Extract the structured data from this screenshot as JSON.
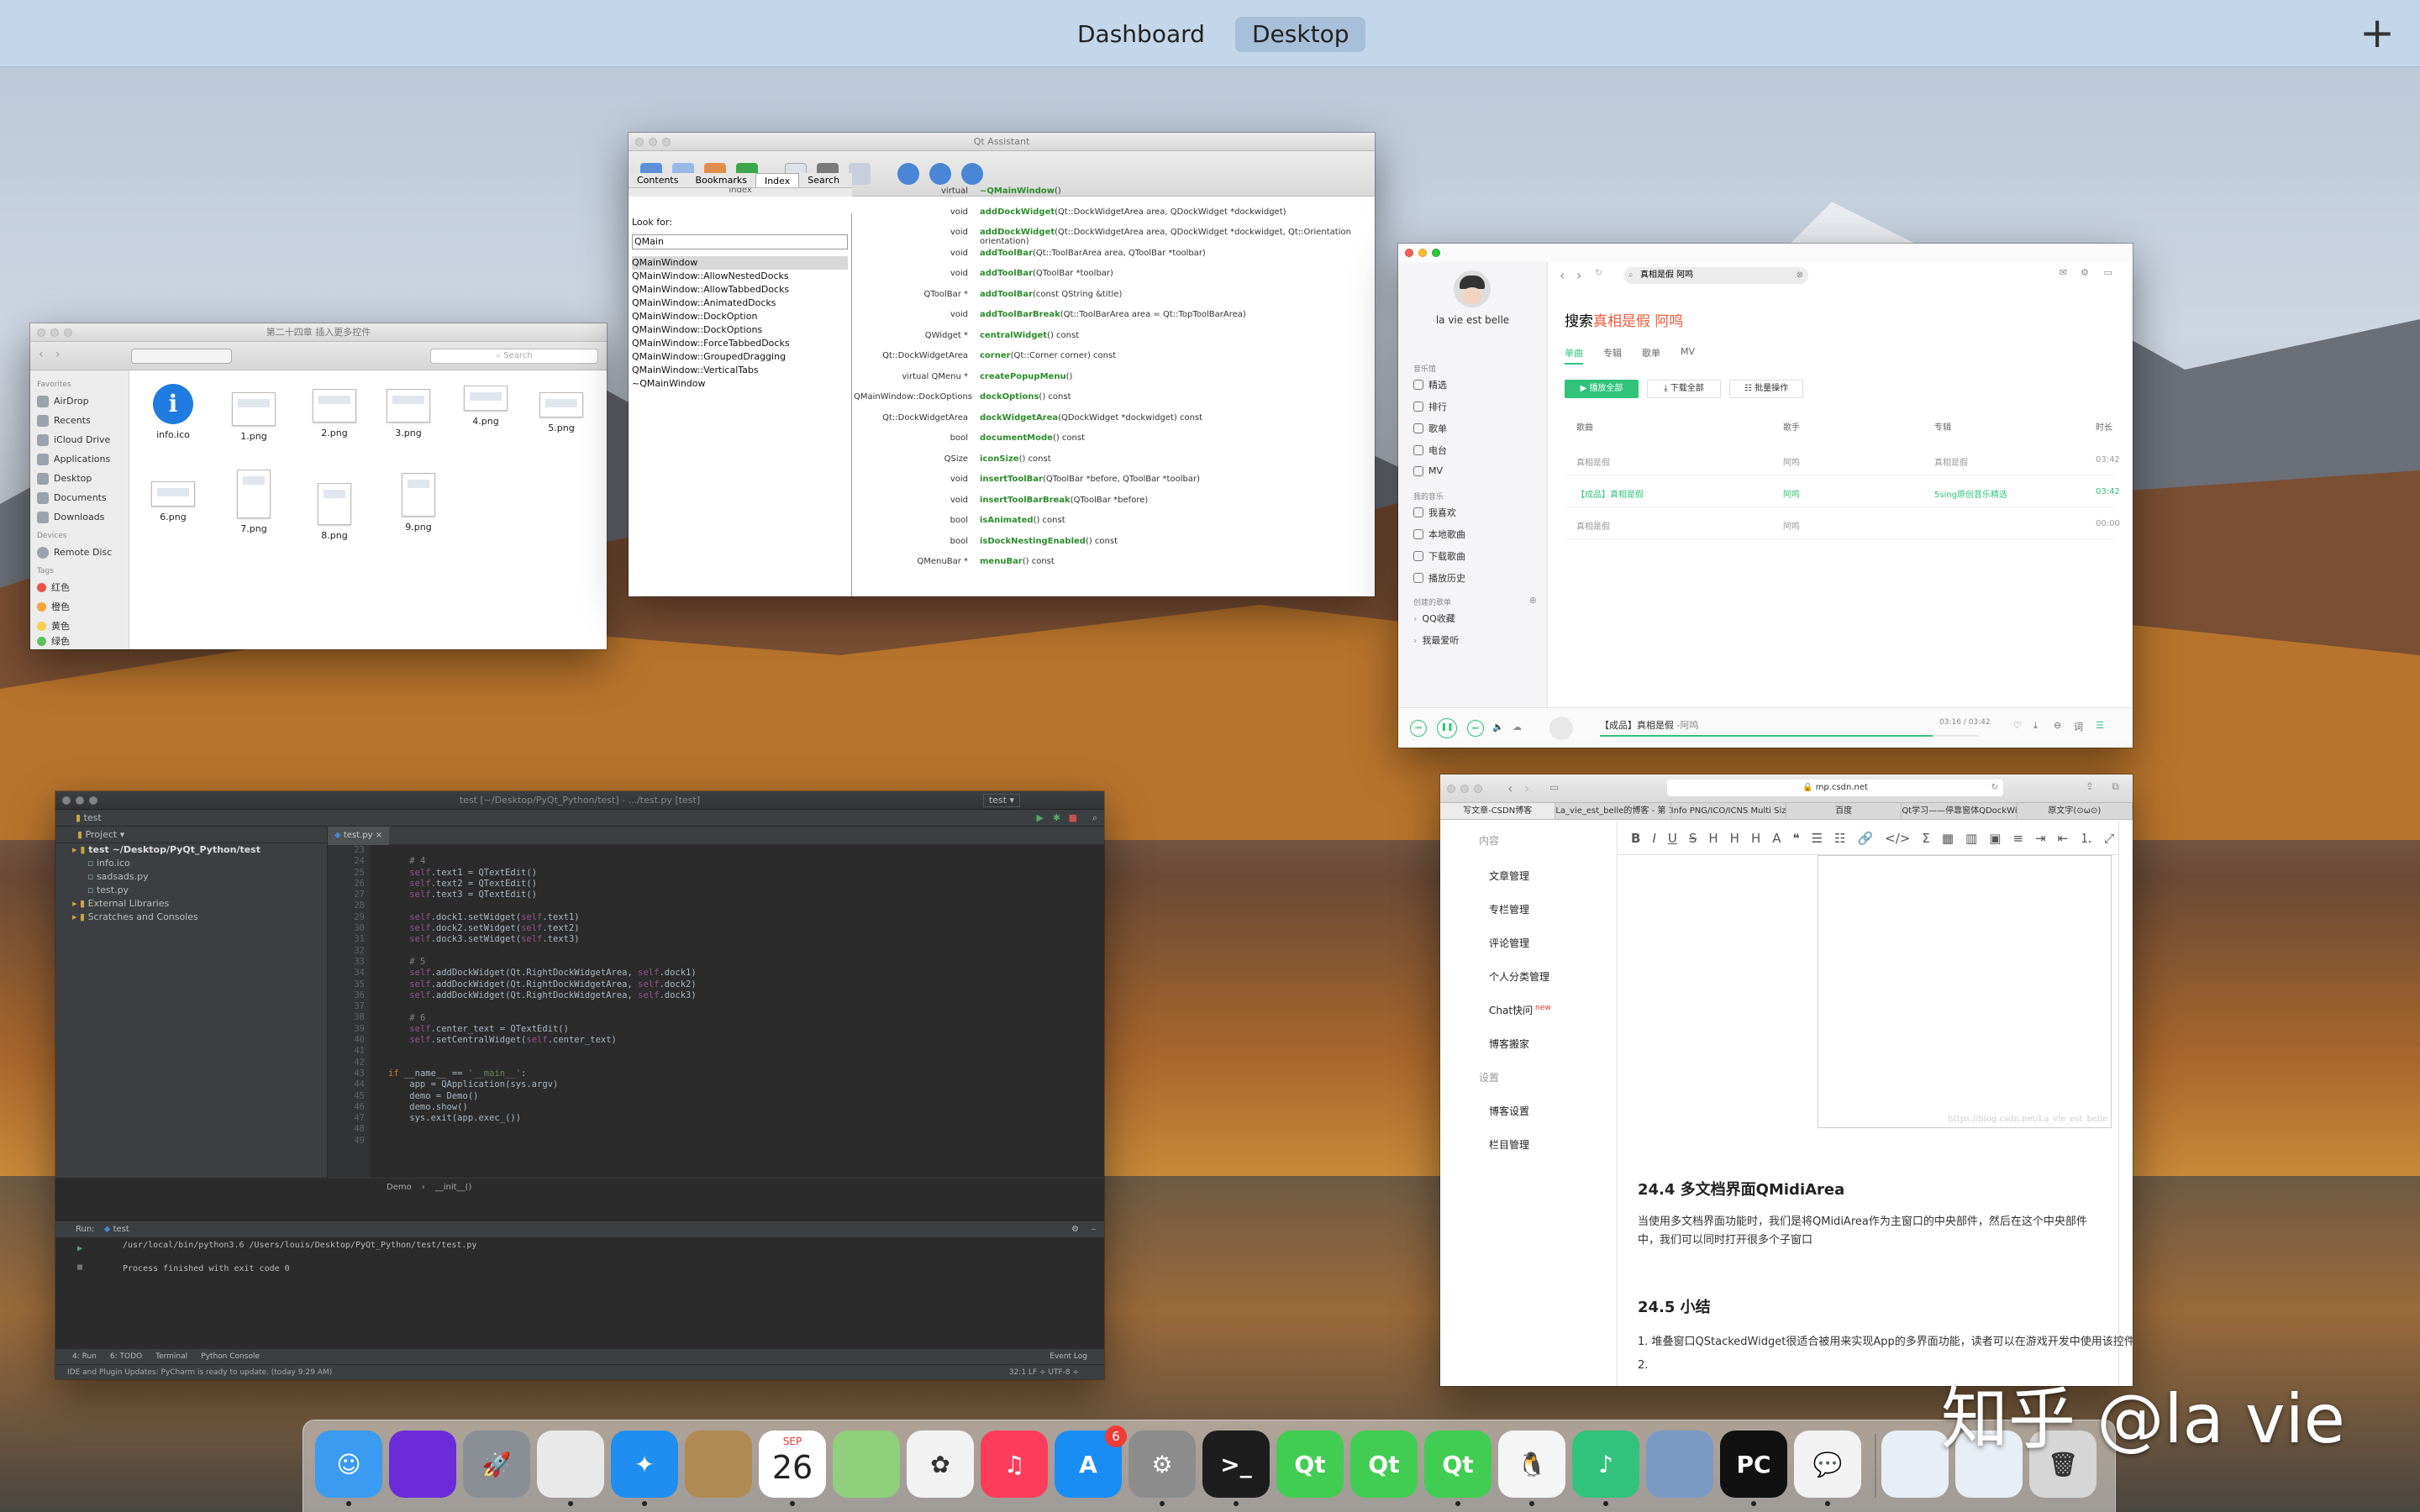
{
  "mission_control": {
    "spaces": [
      "Dashboard",
      "Desktop"
    ],
    "active_space": "Desktop",
    "add_label": "+"
  },
  "finder": {
    "title": "第二十四章 插入更多控件",
    "search_placeholder": "Search",
    "favorites_header": "Favorites",
    "favorites": [
      "AirDrop",
      "Recents",
      "iCloud Drive",
      "Applications",
      "Desktop",
      "Documents",
      "Downloads"
    ],
    "devices_header": "Devices",
    "devices": [
      "Remote Disc"
    ],
    "tags_header": "Tags",
    "tags": [
      {
        "name": "红色",
        "color": "#f0524a"
      },
      {
        "name": "橙色",
        "color": "#f7a23b"
      },
      {
        "name": "黄色",
        "color": "#f5d04a"
      },
      {
        "name": "绿色",
        "color": "#5ac05a"
      }
    ],
    "files": [
      "info.ico",
      "1.png",
      "2.png",
      "3.png",
      "4.png",
      "5.png",
      "6.png",
      "7.png",
      "8.png",
      "9.png"
    ]
  },
  "qt_assistant": {
    "title": "Qt Assistant",
    "tabs": [
      "Contents",
      "Bookmarks",
      "Index",
      "Search"
    ],
    "active_tab": "Index",
    "panel_title": "Index",
    "look_for_label": "Look for:",
    "search_value": "QMain",
    "index_items": [
      "QMainWindow",
      "QMainWindow::AllowNestedDocks",
      "QMainWindow::AllowTabbedDocks",
      "QMainWindow::AnimatedDocks",
      "QMainWindow::DockOption",
      "QMainWindow::DockOptions",
      "QMainWindow::ForceTabbedDocks",
      "QMainWindow::GroupedDragging",
      "QMainWindow::VerticalTabs",
      "~QMainWindow"
    ],
    "members": [
      {
        "type": "virtual",
        "name": "~QMainWindow",
        "args": "()"
      },
      {
        "type": "void",
        "name": "addDockWidget",
        "args": "(Qt::DockWidgetArea area, QDockWidget *dockwidget)"
      },
      {
        "type": "void",
        "name": "addDockWidget",
        "args": "(Qt::DockWidgetArea area, QDockWidget *dockwidget, Qt::Orientation orientation)"
      },
      {
        "type": "void",
        "name": "addToolBar",
        "args": "(Qt::ToolBarArea area, QToolBar *toolbar)"
      },
      {
        "type": "void",
        "name": "addToolBar",
        "args": "(QToolBar *toolbar)"
      },
      {
        "type": "QToolBar *",
        "name": "addToolBar",
        "args": "(const QString &title)"
      },
      {
        "type": "void",
        "name": "addToolBarBreak",
        "args": "(Qt::ToolBarArea area = Qt::TopToolBarArea)"
      },
      {
        "type": "QWidget *",
        "name": "centralWidget",
        "args": "() const"
      },
      {
        "type": "Qt::DockWidgetArea",
        "name": "corner",
        "args": "(Qt::Corner corner) const"
      },
      {
        "type": "virtual QMenu *",
        "name": "createPopupMenu",
        "args": "()"
      },
      {
        "type": "QMainWindow::DockOptions",
        "name": "dockOptions",
        "args": "() const"
      },
      {
        "type": "Qt::DockWidgetArea",
        "name": "dockWidgetArea",
        "args": "(QDockWidget *dockwidget) const"
      },
      {
        "type": "bool",
        "name": "documentMode",
        "args": "() const"
      },
      {
        "type": "QSize",
        "name": "iconSize",
        "args": "() const"
      },
      {
        "type": "void",
        "name": "insertToolBar",
        "args": "(QToolBar *before, QToolBar *toolbar)"
      },
      {
        "type": "void",
        "name": "insertToolBarBreak",
        "args": "(QToolBar *before)"
      },
      {
        "type": "bool",
        "name": "isAnimated",
        "args": "() const"
      },
      {
        "type": "bool",
        "name": "isDockNestingEnabled",
        "args": "() const"
      },
      {
        "type": "QMenuBar *",
        "name": "menuBar",
        "args": "() const"
      }
    ]
  },
  "music": {
    "user": "la vie est belle",
    "search_value": "真相是假 阿鸣",
    "nav_header": "音乐馆",
    "nav": [
      "精选",
      "排行",
      "歌单",
      "电台",
      "MV"
    ],
    "mine_header": "我的音乐",
    "mine": [
      "我喜欢",
      "本地歌曲",
      "下载歌曲",
      "播放历史"
    ],
    "created_header": "创建的歌单",
    "playlists": [
      "QQ收藏",
      "我最爱听"
    ],
    "result_prefix": "搜索",
    "result_query": "真相是假 阿鸣",
    "tabs": [
      "单曲",
      "专辑",
      "歌单",
      "MV"
    ],
    "actions": [
      "播放全部",
      "下载全部",
      "批量操作"
    ],
    "columns": [
      "歌曲",
      "歌手",
      "专辑",
      "时长"
    ],
    "rows": [
      {
        "song": "真相是假",
        "singer": "阿鸣",
        "album": "真相是假",
        "time": "03:42"
      },
      {
        "song": "【成品】真相是假",
        "singer": "阿鸣",
        "album": "5sing原创音乐精选",
        "time": "03:42"
      },
      {
        "song": "真相是假",
        "singer": "阿鸣",
        "album": "",
        "time": "00:00"
      }
    ],
    "now_playing": "【成品】真相是假",
    "now_playing_artist": "-阿鸣",
    "progress_time": "03:16 / 03:42",
    "progress": 0.88,
    "accent": "#31c27c"
  },
  "csdn": {
    "url": "mp.csdn.net",
    "tabs": [
      "写文章-CSDN博客",
      "La_vie_est_belle的博客 - 第 1...",
      "Info PNG/ICO/ICNS Multi Size I...",
      "百度",
      "Qt学习——停靠窗体QDockWi...",
      "原文字(⊙ω⊙)"
    ],
    "side_header1": "内容",
    "side_items1": [
      "文章管理",
      "专栏管理",
      "评论管理",
      "个人分类管理",
      "Chat快问",
      "博客搬家"
    ],
    "new_badge": "new",
    "side_header2": "设置",
    "side_items2": [
      "博客设置",
      "栏目管理"
    ],
    "watermark_url": "https://blog.csdn.net/La_vie_est_belle",
    "heading1": "24.4 多文档界面QMidiArea",
    "para1": "当使用多文档界面功能时，我们是将QMidiArea作为主窗口的中央部件，然后在这个中央部件中，我们可以同时打开很多个子窗口",
    "heading2": "24.5 小结",
    "list1": "1. 堆叠窗口QStackedWidget很适合被用来实现App的多界面功能，读者可以在游戏开发中使用该控件；",
    "list2": "2."
  },
  "pycharm": {
    "title": "test [~/Desktop/PyQt_Python/test] - .../test.py [test]",
    "breadcrumb": "test",
    "project_label": "Project",
    "run_config": "test",
    "editor_tab": "test.py",
    "tree": [
      {
        "label": "test ~/Desktop/PyQt_Python/test",
        "depth": 0
      },
      {
        "label": "info.ico",
        "depth": 1
      },
      {
        "label": "sadsads.py",
        "depth": 1
      },
      {
        "label": "test.py",
        "depth": 1
      },
      {
        "label": "External Libraries",
        "depth": 0
      },
      {
        "label": "Scratches and Consoles",
        "depth": 0
      }
    ],
    "line_numbers": [
      "23",
      "24",
      "25",
      "26",
      "27",
      "28",
      "29",
      "30",
      "31",
      "32",
      "33",
      "34",
      "35",
      "36",
      "37",
      "38",
      "39",
      "40",
      "41",
      "42",
      "43",
      "44",
      "45",
      "46",
      "47",
      "48",
      "49"
    ],
    "code": [
      "",
      "    # 4",
      "    self.text1 = QTextEdit()",
      "    self.text2 = QTextEdit()",
      "    self.text3 = QTextEdit()",
      "",
      "    self.dock1.setWidget(self.text1)",
      "    self.dock2.setWidget(self.text2)",
      "    self.dock3.setWidget(self.text3)",
      "",
      "    # 5",
      "    self.addDockWidget(Qt.RightDockWidgetArea, self.dock1)",
      "    self.addDockWidget(Qt.RightDockWidgetArea, self.dock2)",
      "    self.addDockWidget(Qt.RightDockWidgetArea, self.dock3)",
      "",
      "    # 6",
      "    self.center_text = QTextEdit()",
      "    self.setCentralWidget(self.center_text)",
      "",
      "",
      "if __name__ == '__main__':",
      "    app = QApplication(sys.argv)",
      "    demo = Demo()",
      "    demo.show()",
      "    sys.exit(app.exec_())",
      "",
      ""
    ],
    "code_crumb": [
      "Demo",
      "__init__()"
    ],
    "run_label": "Run:",
    "run_tab": "test",
    "run_cmd": "/usr/local/bin/python3.6 /Users/louis/Desktop/PyQt_Python/test/test.py",
    "run_output": "Process finished with exit code 0",
    "bottom_tabs": [
      "4: Run",
      "6: TODO",
      "Terminal",
      "Python Console"
    ],
    "event_log": "Event Log",
    "status": "IDE and Plugin Updates: PyCharm is ready to update. (today 9:29 AM)",
    "status_right": "32:1  LF ÷  UTF-8 ÷"
  },
  "dock": {
    "apps": [
      {
        "name": "Finder",
        "color": "#3a9bf0",
        "glyph": "☺"
      },
      {
        "name": "Siri",
        "color": "#6b2bd9",
        "glyph": ""
      },
      {
        "name": "Launchpad",
        "color": "#8a8f96",
        "glyph": "🚀"
      },
      {
        "name": "Chrome",
        "color": "#e9e9e9",
        "glyph": ""
      },
      {
        "name": "Safari",
        "color": "#1f8ef0",
        "glyph": "✦"
      },
      {
        "name": "Notes",
        "color": "#b08a53",
        "glyph": ""
      },
      {
        "name": "Calendar",
        "color": "#ffffff",
        "glyph": "26"
      },
      {
        "name": "Maps",
        "color": "#8fd07c",
        "glyph": ""
      },
      {
        "name": "Photos",
        "color": "#f2f2f2",
        "glyph": "✿"
      },
      {
        "name": "Music",
        "color": "#fc3c5a",
        "glyph": "♫"
      },
      {
        "name": "App Store",
        "color": "#1a8df5",
        "glyph": "A"
      },
      {
        "name": "System Preferences",
        "color": "#8c8c8c",
        "glyph": "⚙"
      },
      {
        "name": "Terminal",
        "color": "#1d1d1d",
        "glyph": ">_"
      },
      {
        "name": "Qt Creator",
        "color": "#41cd52",
        "glyph": "Qt"
      },
      {
        "name": "Qt Assistant",
        "color": "#41cd52",
        "glyph": "Qt"
      },
      {
        "name": "Qt Designer",
        "color": "#41cd52",
        "glyph": "Qt"
      },
      {
        "name": "QQ",
        "color": "#f5f5f5",
        "glyph": "🐧"
      },
      {
        "name": "QQ Music",
        "color": "#31c27c",
        "glyph": "♪"
      },
      {
        "name": "Preview",
        "color": "#7a9ac4",
        "glyph": ""
      },
      {
        "name": "PyCharm",
        "color": "#111111",
        "glyph": "PC"
      },
      {
        "name": "WeChat",
        "color": "#f2f2f2",
        "glyph": "💬"
      },
      {
        "name": "Downloads",
        "color": "#e8eef5",
        "glyph": ""
      },
      {
        "name": "Documents",
        "color": "#e8eef5",
        "glyph": ""
      },
      {
        "name": "Trash",
        "color": "#d6d6d6",
        "glyph": "🗑"
      }
    ],
    "calendar_month": "SEP",
    "calendar_day": "26",
    "appstore_badge": "6"
  },
  "watermark": "知乎 @la vie"
}
